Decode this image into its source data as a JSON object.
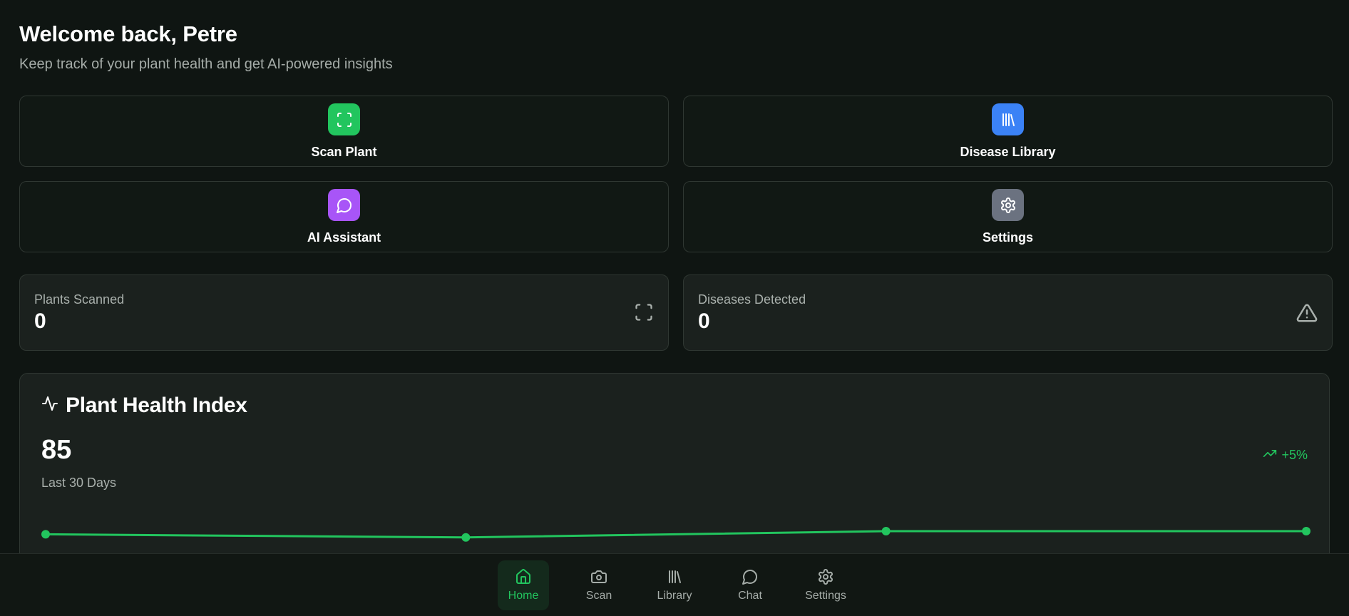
{
  "header": {
    "welcome": "Welcome back, Petre",
    "subtitle": "Keep track of your plant health and get AI-powered insights"
  },
  "actions": [
    {
      "label": "Scan Plant",
      "icon": "scan-icon",
      "color": "#22c55e"
    },
    {
      "label": "Disease Library",
      "icon": "library-icon",
      "color": "#3b82f6"
    },
    {
      "label": "AI Assistant",
      "icon": "chat-icon",
      "color": "#a855f7"
    },
    {
      "label": "Settings",
      "icon": "gear-icon",
      "color": "#6b7280"
    }
  ],
  "stats": [
    {
      "label": "Plants Scanned",
      "value": "0",
      "icon": "scan-icon"
    },
    {
      "label": "Diseases Detected",
      "value": "0",
      "icon": "warning-icon"
    }
  ],
  "health": {
    "title": "Plant Health Index",
    "value": "85",
    "trend": "+5%",
    "period": "Last 30 Days",
    "accent": "#22c55e"
  },
  "chart_data": {
    "type": "line",
    "values": [
      84,
      82,
      86,
      86
    ],
    "ylim": [
      70,
      100
    ]
  },
  "nav": [
    {
      "label": "Home",
      "icon": "home-icon",
      "active": true
    },
    {
      "label": "Scan",
      "icon": "camera-icon",
      "active": false
    },
    {
      "label": "Library",
      "icon": "library-icon",
      "active": false
    },
    {
      "label": "Chat",
      "icon": "chat-icon",
      "active": false
    },
    {
      "label": "Settings",
      "icon": "gear-icon",
      "active": false
    }
  ]
}
